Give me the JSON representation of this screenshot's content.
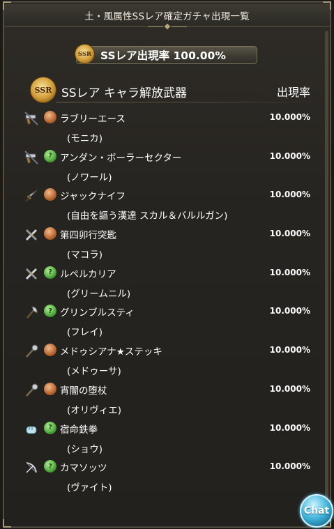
{
  "header": {
    "title": "土・風属性SSレア確定ガチャ出現一覧"
  },
  "summary": {
    "badge": "SSR",
    "rate_text": "SSレア出現率 100.00%"
  },
  "section": {
    "badge": "SSR",
    "title": "SSレア キャラ解放武器",
    "rate_label": "出現率"
  },
  "items": [
    {
      "weapon_icon": "gun-icon",
      "element": "earth",
      "name": "ラブリーエース",
      "character": "(モニカ)",
      "rate": "10.000%"
    },
    {
      "weapon_icon": "gun-icon",
      "element": "wind",
      "name": "アンダン・ボーラーセクター",
      "character": "(ノワール)",
      "rate": "10.000%"
    },
    {
      "weapon_icon": "dagger-icon",
      "element": "earth",
      "name": "ジャックナイフ",
      "character": "(自由を謳う漢達 スカル＆バルルガン)",
      "rate": "10.000%"
    },
    {
      "weapon_icon": "sword-icon",
      "element": "earth",
      "name": "第四卯行突匙",
      "character": "(マコラ)",
      "rate": "10.000%"
    },
    {
      "weapon_icon": "sword-icon",
      "element": "wind",
      "name": "ルペルカリア",
      "character": "(グリームニル)",
      "rate": "10.000%"
    },
    {
      "weapon_icon": "axe-icon",
      "element": "wind",
      "name": "グリンブルスティ",
      "character": "(フレイ)",
      "rate": "10.000%"
    },
    {
      "weapon_icon": "staff-icon",
      "element": "earth",
      "name": "メドゥシアナ★ステッキ",
      "character": "(メドゥーサ)",
      "rate": "10.000%"
    },
    {
      "weapon_icon": "staff-icon",
      "element": "earth",
      "name": "宵闇の堕杖",
      "character": "(オリヴィエ)",
      "rate": "10.000%"
    },
    {
      "weapon_icon": "fist-icon",
      "element": "wind",
      "name": "宿命鉄拳",
      "character": "(ショウ)",
      "rate": "10.000%"
    },
    {
      "weapon_icon": "bow-icon",
      "element": "wind",
      "name": "カマソッツ",
      "character": "(ヴァイト)",
      "rate": "10.000%"
    }
  ],
  "chat": {
    "label": "Chat"
  },
  "colors": {
    "earth": "#b8652f",
    "wind": "#4ca73a",
    "frame": "#6b6452",
    "chat": "#3fb3d9"
  }
}
